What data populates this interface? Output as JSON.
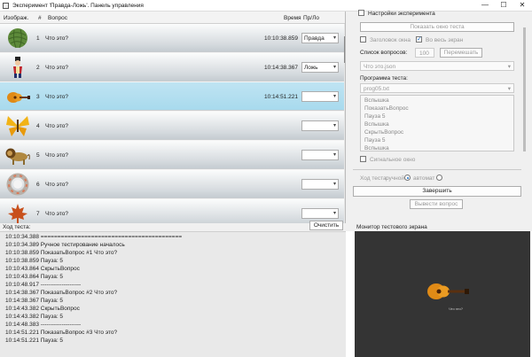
{
  "window": {
    "title": "Эксперимент 'Правда-Ложь'. Панель управления",
    "min_glyph": "—",
    "max_glyph": "☐",
    "close_glyph": "✕"
  },
  "table": {
    "headers": {
      "image": "Изображ.",
      "num": "#",
      "question": "Вопрос",
      "time": "Время",
      "truefalse": "Пр/Ло"
    },
    "rows": [
      {
        "icon": "yarn-ball-icon",
        "num": "1",
        "question": "Что это?",
        "time": "10:10:38.859",
        "answer": "Правда"
      },
      {
        "icon": "ringmaster-figure-icon",
        "num": "2",
        "question": "Что это?",
        "time": "10:14:38.367",
        "answer": "Ложь"
      },
      {
        "icon": "guitar-icon",
        "num": "3",
        "question": "Что это?",
        "time": "10:14:51.221",
        "answer": ""
      },
      {
        "icon": "butterfly-icon",
        "num": "4",
        "question": "Что это?",
        "time": "",
        "answer": ""
      },
      {
        "icon": "lion-icon",
        "num": "5",
        "question": "Что это?",
        "time": "",
        "answer": ""
      },
      {
        "icon": "wreath-icon",
        "num": "6",
        "question": "Что это?",
        "time": "",
        "answer": ""
      },
      {
        "icon": "maple-leaf-icon",
        "num": "7",
        "question": "Что это?",
        "time": "",
        "answer": ""
      }
    ],
    "selected_row": 3
  },
  "log": {
    "label": "Ход теста:",
    "clear_button": "Очистить",
    "lines": [
      "10:10:34.388 ==========================================",
      "10:10:34.389 Ручное тестирование началось",
      "10:10:38.859 ПоказатьВопрос #1 Что это?",
      "10:10:38.859 Пауза: 5",
      "10:10:43.864 СкрытьВопрос",
      "10:10:43.864 Пауза: 5",
      "10:10:48.917 ---------------------",
      "10:14:38.367 ПоказатьВопрос #2 Что это?",
      "10:14:38.367 Пауза: 5",
      "10:14:43.382 СкрытьВопрос",
      "10:14:43.382 Пауза: 5",
      "10:14:48.383 ---------------------",
      "10:14:51.221 ПоказатьВопрос #3 Что это?",
      "10:14:51.221 Пауза: 5"
    ]
  },
  "settings": {
    "experiment_settings": "Настройки эксперимента",
    "show_test_window": "Показать окно теста",
    "window_title_checkbox": "Заголовок окна",
    "fullscreen_checkbox": "Во весь экран",
    "question_list_label": "Список вопросов:",
    "question_count": "100",
    "shuffle_button": "Перемешать",
    "question_file": "Что это.json",
    "test_program_label": "Программа теста:",
    "program_file": "prog05.txt",
    "program_steps": [
      "Вспышка",
      "ПоказатьВопрос",
      "Пауза 5",
      "Вспышка",
      "СкрытьВопрос",
      "Пауза 5",
      "Вспышка"
    ],
    "signal_window_checkbox": "Сигнальное окно",
    "test_mode_label": "Ход теста:",
    "manual_label": "ручной",
    "auto_label": "автомат",
    "finish_button": "Завершить",
    "ask_question_button": "Вывести вопрос"
  },
  "monitor": {
    "label": "Монитор тестового экрана",
    "preview_icon": "guitar-icon",
    "caption": "Что это?"
  },
  "colors": {
    "selected_row": "#a8daed",
    "accent": "#1b6fc7",
    "monitor_bg": "#343434"
  }
}
